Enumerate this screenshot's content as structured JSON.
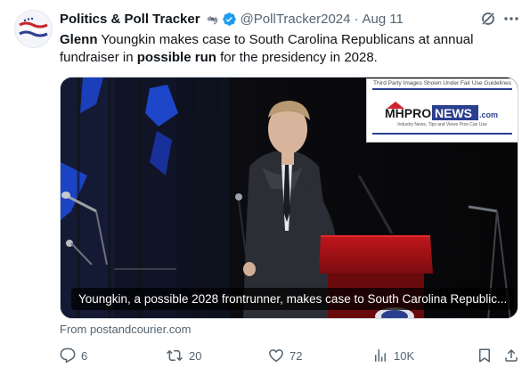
{
  "post": {
    "author_name": "Politics & Poll Tracker",
    "handle": "@PollTracker2024",
    "separator": "·",
    "date": "Aug 11",
    "text_parts": [
      {
        "text": "Glenn",
        "bold": true
      },
      {
        "text": " Youngkin makes case to South Carolina Republicans at annual fundraiser in ",
        "bold": false
      },
      {
        "text": "possible run",
        "bold": true
      },
      {
        "text": " for the presidency in 2028.",
        "bold": false
      }
    ]
  },
  "media": {
    "watermark_note": "Third Party Images Shown Under Fair Use Guidelines",
    "watermark_brand_1": "MHPRO",
    "watermark_brand_2": "NEWS",
    "watermark_brand_3": ".com",
    "watermark_tagline": "Industry News, Tips and Views Pros Can Use",
    "caption": "Youngkin, a possible 2028 frontrunner, makes case to South Carolina Republic..."
  },
  "source": "From postandcourier.com",
  "actions": {
    "replies": "6",
    "reposts": "20",
    "likes": "72",
    "views": "10K"
  },
  "icons": {
    "avatar": "flag-avatar-icon",
    "emoji": "satellite-icon",
    "verified": "verified-badge-icon",
    "grok": "grok-icon",
    "more": "more-icon",
    "reply": "reply-icon",
    "repost": "repost-icon",
    "like": "heart-icon",
    "views": "views-icon",
    "bookmark": "bookmark-icon",
    "share": "share-icon"
  },
  "colors": {
    "text": "#0f1419",
    "secondary": "#536471",
    "verified": "#1d9bf0",
    "brand_red": "#d2232a",
    "brand_blue": "#2b3f8f"
  }
}
